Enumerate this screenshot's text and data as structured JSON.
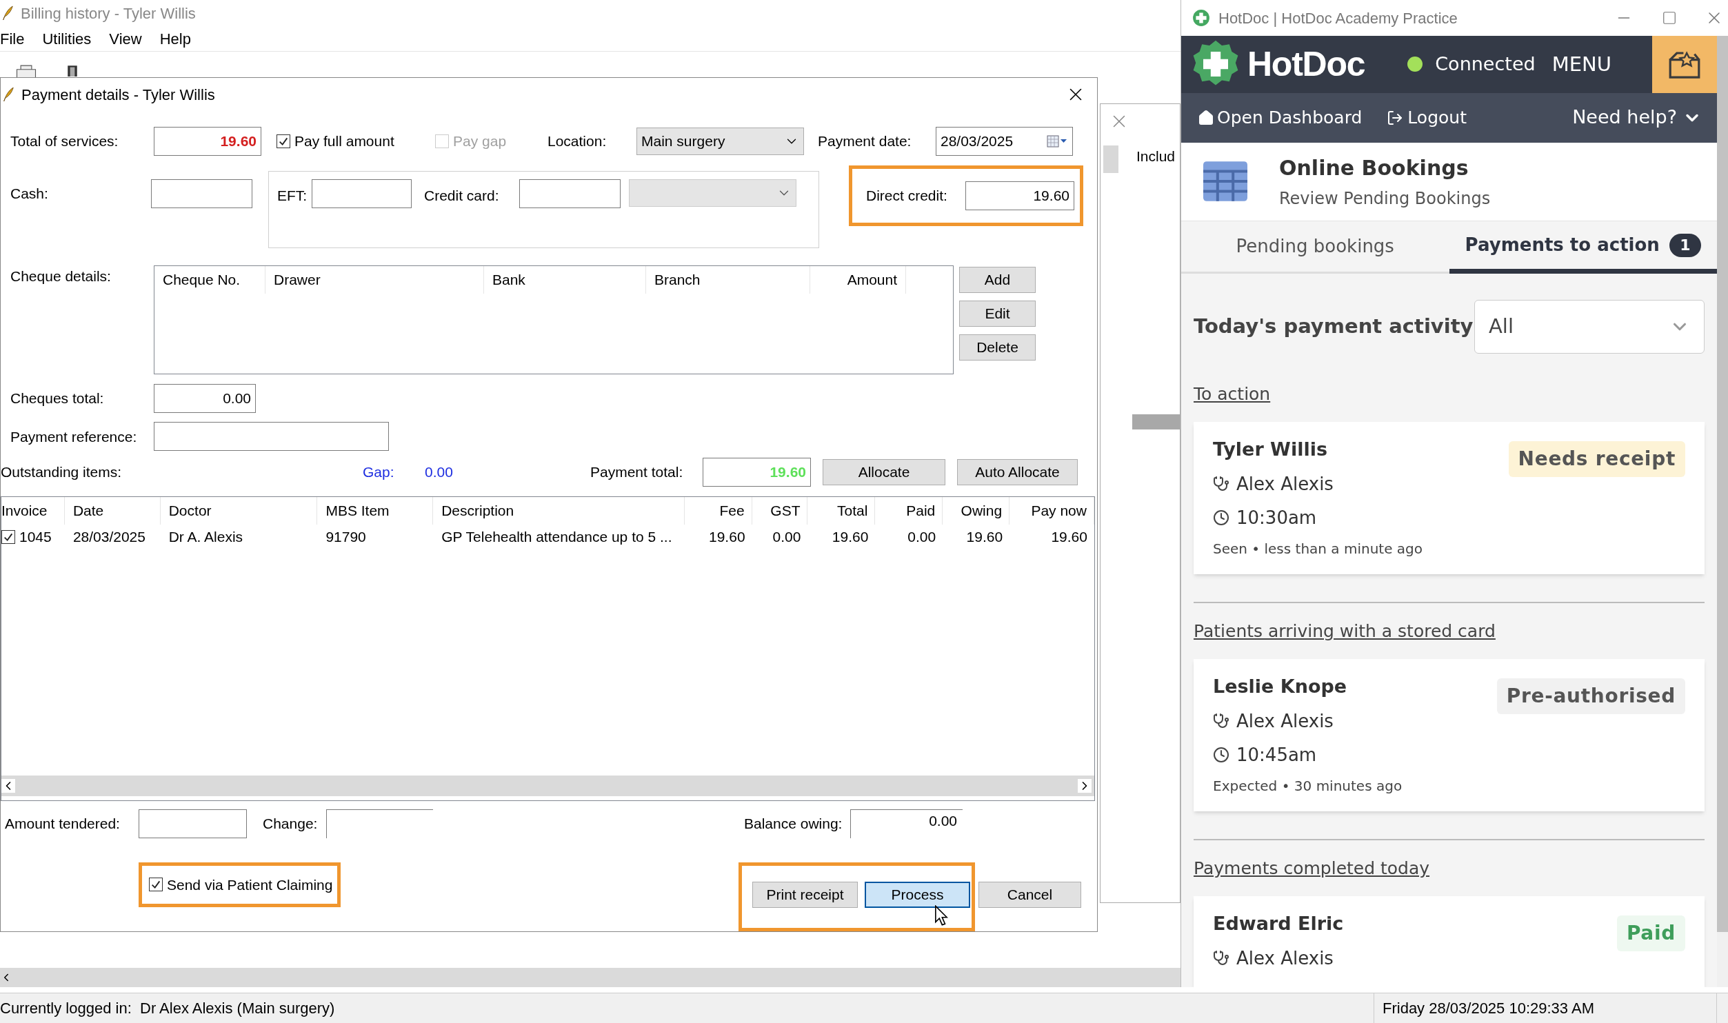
{
  "app_window": {
    "title": "Billing history - Tyler Willis",
    "menu": [
      "File",
      "Utilities",
      "View",
      "Help"
    ]
  },
  "background_panel": {
    "partial_text": "Includ"
  },
  "dialog": {
    "title": "Payment details - Tyler Willis",
    "total_of_services": {
      "label": "Total of services:",
      "value": "19.60"
    },
    "pay_full_amount": {
      "label": "Pay full amount",
      "checked": true,
      "disabled": false
    },
    "pay_gap": {
      "label": "Pay gap",
      "checked": false,
      "disabled": true
    },
    "location": {
      "label": "Location:",
      "value": "Main surgery"
    },
    "payment_date": {
      "label": "Payment date:",
      "value": "28/03/2025"
    },
    "cash": {
      "label": "Cash:"
    },
    "eft": {
      "label": "EFT:"
    },
    "credit_card": {
      "label": "Credit card:"
    },
    "direct_credit": {
      "label": "Direct credit:",
      "value": "19.60",
      "highlighted": true
    },
    "cheque_details": {
      "label": "Cheque details:",
      "columns": [
        "Cheque No.",
        "Drawer",
        "Bank",
        "Branch",
        "Amount"
      ],
      "buttons": [
        "Add",
        "Edit",
        "Delete"
      ]
    },
    "cheques_total": {
      "label": "Cheques total:",
      "value": "0.00"
    },
    "payment_reference": {
      "label": "Payment reference:"
    },
    "outstanding_items": {
      "label": "Outstanding items:",
      "gap_label": "Gap:",
      "gap_value": "0.00",
      "payment_total_label": "Payment total:",
      "payment_total": "19.60",
      "buttons": [
        "Allocate",
        "Auto Allocate"
      ]
    },
    "items_table": {
      "columns": [
        "Invoice",
        "Date",
        "Doctor",
        "MBS Item",
        "Description",
        "Fee",
        "GST",
        "Total",
        "Paid",
        "Owing",
        "Pay now"
      ],
      "rows": [
        {
          "checked": true,
          "cells": [
            "1045",
            "28/03/2025",
            "Dr A. Alexis",
            "91790",
            "GP Telehealth attendance up to 5 ...",
            "19.60",
            "0.00",
            "19.60",
            "0.00",
            "19.60",
            "19.60"
          ]
        }
      ]
    },
    "amount_tendered": {
      "label": "Amount tendered:"
    },
    "change": {
      "label": "Change:"
    },
    "balance_owing": {
      "label": "Balance owing:",
      "value": "0.00"
    },
    "send_via_patient_claiming": {
      "label": "Send via Patient Claiming",
      "checked": true,
      "highlighted": true
    },
    "action_buttons_highlighted": true,
    "buttons": [
      {
        "label": "Print receipt",
        "kind": "normal"
      },
      {
        "label": "Process",
        "kind": "focused"
      },
      {
        "label": "Cancel",
        "kind": "normal"
      }
    ]
  },
  "hotdoc": {
    "title": "HotDoc | HotDoc Academy Practice",
    "brand": "HotDoc",
    "status": "Connected",
    "connected": true,
    "menu": "MENU",
    "nav": {
      "open_dashboard": "Open Dashboard",
      "logout": "Logout",
      "help": "Need help?"
    },
    "feature": {
      "title": "Online Bookings",
      "subtitle": "Review Pending Bookings"
    },
    "tabs": [
      {
        "label": "Pending bookings",
        "selected": false
      },
      {
        "label": "Payments to action",
        "badge": "1",
        "selected": true
      }
    ],
    "activity": {
      "label": "Today's payment activity",
      "filter": "All"
    },
    "sections": [
      {
        "heading": "To action",
        "cards": [
          {
            "name": "Tyler Willis",
            "doctor": "Alex Alexis",
            "time": "10:30am",
            "note": "Seen • less than a minute ago",
            "status": "Needs receipt",
            "kind": "needs_receipt"
          }
        ]
      },
      {
        "heading": "Patients arriving with a stored card",
        "cards": [
          {
            "name": "Leslie Knope",
            "doctor": "Alex Alexis",
            "time": "10:45am",
            "note": "Expected • 30 minutes ago",
            "status": "Pre-authorised",
            "kind": "pre_authorised"
          }
        ]
      },
      {
        "heading": "Payments completed today",
        "cards": [
          {
            "name": "Edward Elric",
            "doctor": "Alex Alexis",
            "status": "Paid",
            "kind": "paid"
          }
        ]
      }
    ]
  },
  "status_bar": {
    "logged_in": "Currently logged in:  Dr Alex Alexis (Main surgery)",
    "datetime": "Friday 28/03/2025 10:29:33 AM"
  }
}
